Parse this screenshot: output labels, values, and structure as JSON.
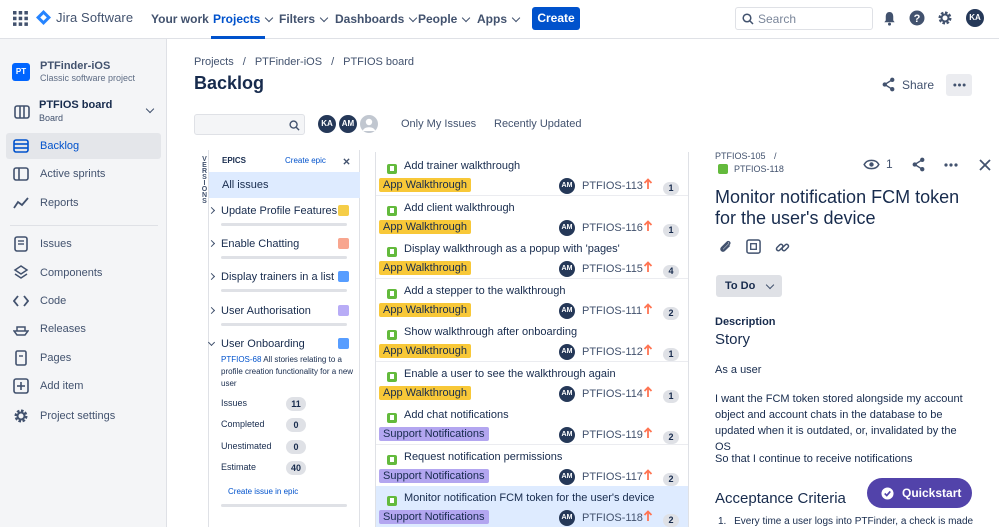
{
  "nav": {
    "product": "Jira Software",
    "your_work": "Your work",
    "projects": "Projects",
    "filters": "Filters",
    "dashboards": "Dashboards",
    "people": "People",
    "apps": "Apps",
    "create": "Create",
    "search_placeholder": "Search",
    "user_initials": "KA"
  },
  "sidebar": {
    "project_name": "PTFinder-iOS",
    "project_type": "Classic software project",
    "project_badge": "PT",
    "board_name": "PTFIOS board",
    "board_type": "Board",
    "items": [
      {
        "label": "Backlog"
      },
      {
        "label": "Active sprints"
      },
      {
        "label": "Reports"
      },
      {
        "label": "Issues"
      },
      {
        "label": "Components"
      },
      {
        "label": "Code"
      },
      {
        "label": "Releases"
      },
      {
        "label": "Pages"
      },
      {
        "label": "Add item"
      },
      {
        "label": "Project settings"
      }
    ]
  },
  "breadcrumb": [
    "Projects",
    "PTFinder-iOS",
    "PTFIOS board"
  ],
  "page_title": "Backlog",
  "toolbar": {
    "avatars": [
      "KA",
      "AM"
    ],
    "only_my_issues": "Only My Issues",
    "recently_updated": "Recently Updated",
    "share": "Share"
  },
  "versions_label": "VERSIONS",
  "epics": {
    "header": "EPICS",
    "create_epic": "Create epic",
    "all_issues": "All issues",
    "list": [
      {
        "name": "Update Profile Features",
        "color": "#f5cd47"
      },
      {
        "name": "Enable Chatting",
        "color": "#f8a68f"
      },
      {
        "name": "Display trainers in a list",
        "color": "#579dff"
      },
      {
        "name": "User Authorisation",
        "color": "#b8acf6"
      },
      {
        "name": "User Onboarding",
        "color": "#579dff"
      }
    ],
    "expanded": {
      "key": "PTFIOS-68",
      "description": "All stories relating to a profile creation functionality for a new user",
      "stats": [
        {
          "label": "Issues",
          "value": "11"
        },
        {
          "label": "Completed",
          "value": "0"
        },
        {
          "label": "Unestimated",
          "value": "0"
        },
        {
          "label": "Estimate",
          "value": "40"
        }
      ],
      "create_issue": "Create issue in epic"
    }
  },
  "issues": [
    {
      "summary": "Add trainer walkthrough",
      "epic": "App Walkthrough",
      "epic_color": "#f8c838",
      "assignee": "AM",
      "key": "PTFIOS-113",
      "estimate": "1"
    },
    {
      "summary": "Add client walkthrough",
      "epic": "App Walkthrough",
      "epic_color": "#f8c838",
      "assignee": "AM",
      "key": "PTFIOS-116",
      "estimate": "1"
    },
    {
      "summary": "Display walkthrough as a popup with 'pages'",
      "epic": "App Walkthrough",
      "epic_color": "#f8c838",
      "assignee": "AM",
      "key": "PTFIOS-115",
      "estimate": "4"
    },
    {
      "summary": "Add a stepper to the walkthrough",
      "epic": "App Walkthrough",
      "epic_color": "#f8c838",
      "assignee": "AM",
      "key": "PTFIOS-111",
      "estimate": "2"
    },
    {
      "summary": "Show walkthrough after onboarding",
      "epic": "App Walkthrough",
      "epic_color": "#f8c838",
      "assignee": "AM",
      "key": "PTFIOS-112",
      "estimate": "1"
    },
    {
      "summary": "Enable a user to see the walkthrough again",
      "epic": "App Walkthrough",
      "epic_color": "#f8c838",
      "assignee": "AM",
      "key": "PTFIOS-114",
      "estimate": "1"
    },
    {
      "summary": "Add chat notifications",
      "epic": "Support Notifications",
      "epic_color": "#b3a6f0",
      "assignee": "AM",
      "key": "PTFIOS-119",
      "estimate": "2"
    },
    {
      "summary": "Request notification permissions",
      "epic": "Support Notifications",
      "epic_color": "#b3a6f0",
      "assignee": "AM",
      "key": "PTFIOS-117",
      "estimate": "2"
    },
    {
      "summary": "Monitor notification FCM token for the user's device",
      "epic": "Support Notifications",
      "epic_color": "#b3a6f0",
      "assignee": "AM",
      "key": "PTFIOS-118",
      "estimate": "2",
      "selected": true
    }
  ],
  "detail": {
    "parent_key": "PTFIOS-105",
    "key": "PTFIOS-118",
    "watchers": "1",
    "title": "Monitor notification FCM token for the user's device",
    "status": "To Do",
    "description_label": "Description",
    "story_heading": "Story",
    "para1": "As a user",
    "para2": "I want the FCM token stored alongside my account object and account chats in the database to be updated when it is outdated, or, invalidated by the OS",
    "para3": "So that I continue to receive notifications",
    "acceptance_heading": "Acceptance Criteria",
    "acceptance_first": "Every time a user logs into PTFinder, a check is made",
    "quickstart": "Quickstart"
  }
}
